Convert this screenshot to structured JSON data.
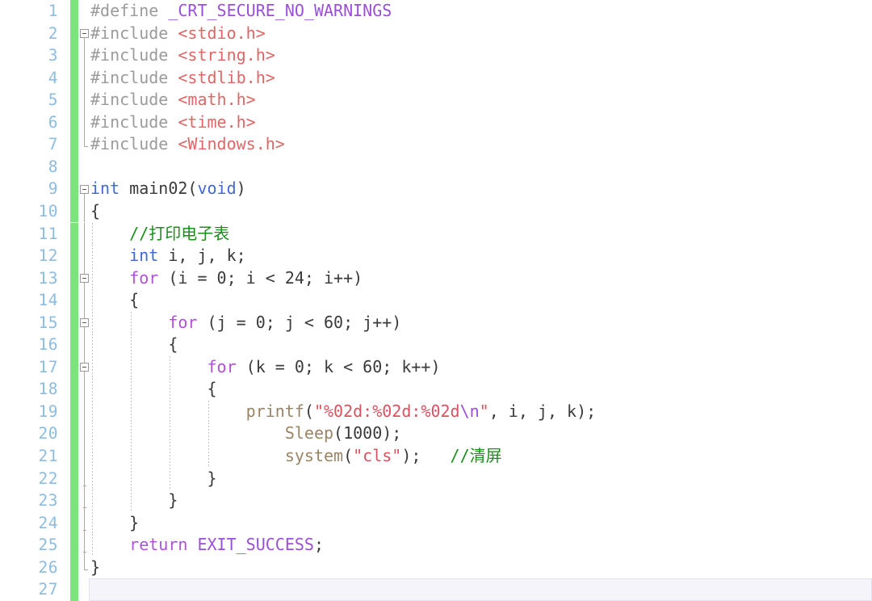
{
  "editor": {
    "name": "code-editor",
    "language": "C",
    "gutter_accent_color": "#7ce47c",
    "line_number_color": "#8cbce0",
    "background_color": "#ffffff",
    "current_line": 27,
    "first_line": 1,
    "last_line": 27,
    "total_lines": 27
  },
  "lines": [
    {
      "n": "1",
      "indent": 0,
      "fold": "none",
      "text": "#define _CRT_SECURE_NO_WARNINGS"
    },
    {
      "n": "2",
      "indent": 0,
      "fold": "start",
      "text": "#include <stdio.h>"
    },
    {
      "n": "3",
      "indent": 0,
      "fold": "body",
      "text": "#include <string.h>"
    },
    {
      "n": "4",
      "indent": 0,
      "fold": "body",
      "text": "#include <stdlib.h>"
    },
    {
      "n": "5",
      "indent": 0,
      "fold": "body",
      "text": "#include <math.h>"
    },
    {
      "n": "6",
      "indent": 0,
      "fold": "body",
      "text": "#include <time.h>"
    },
    {
      "n": "7",
      "indent": 0,
      "fold": "end",
      "text": "#include <Windows.h>"
    },
    {
      "n": "8",
      "indent": 0,
      "fold": "none",
      "text": ""
    },
    {
      "n": "9",
      "indent": 0,
      "fold": "start",
      "text": "int main02(void)"
    },
    {
      "n": "10",
      "indent": 0,
      "fold": "body",
      "text": "{"
    },
    {
      "n": "11",
      "indent": 1,
      "fold": "body",
      "text": "    //打印电子表"
    },
    {
      "n": "12",
      "indent": 1,
      "fold": "body",
      "text": "    int i, j, k;"
    },
    {
      "n": "13",
      "indent": 1,
      "fold": "body",
      "text": "    for (i = 0; i < 24; i++)"
    },
    {
      "n": "14",
      "indent": 1,
      "fold": "body",
      "text": "    {"
    },
    {
      "n": "15",
      "indent": 2,
      "fold": "body",
      "text": "        for (j = 0; j < 60; j++)"
    },
    {
      "n": "16",
      "indent": 2,
      "fold": "body",
      "text": "        {"
    },
    {
      "n": "17",
      "indent": 3,
      "fold": "body",
      "text": "            for (k = 0; k < 60; k++)"
    },
    {
      "n": "18",
      "indent": 3,
      "fold": "body",
      "text": "            {"
    },
    {
      "n": "19",
      "indent": 4,
      "fold": "body",
      "text": "                printf(\"%02d:%02d:%02d\\n\", i, j, k);"
    },
    {
      "n": "20",
      "indent": 4,
      "fold": "body",
      "text": "                    Sleep(1000);"
    },
    {
      "n": "21",
      "indent": 4,
      "fold": "body",
      "text": "                    system(\"cls\");   //清屏"
    },
    {
      "n": "22",
      "indent": 3,
      "fold": "body",
      "text": "            }"
    },
    {
      "n": "23",
      "indent": 2,
      "fold": "body",
      "text": "        }"
    },
    {
      "n": "24",
      "indent": 1,
      "fold": "body",
      "text": "    }"
    },
    {
      "n": "25",
      "indent": 1,
      "fold": "body",
      "text": "    return EXIT_SUCCESS;"
    },
    {
      "n": "26",
      "indent": 0,
      "fold": "end",
      "text": "}"
    },
    {
      "n": "27",
      "indent": 0,
      "fold": "none",
      "text": ""
    }
  ],
  "code_tokens": {
    "l1": [
      [
        "#define ",
        "t-pre"
      ],
      [
        "_CRT_SECURE_NO_WARNINGS",
        "t-macro"
      ]
    ],
    "l2": [
      [
        "#include ",
        "t-pre"
      ],
      [
        "<stdio.h>",
        "t-header"
      ]
    ],
    "l3": [
      [
        "#include ",
        "t-pre"
      ],
      [
        "<string.h>",
        "t-header"
      ]
    ],
    "l4": [
      [
        "#include ",
        "t-pre"
      ],
      [
        "<stdlib.h>",
        "t-header"
      ]
    ],
    "l5": [
      [
        "#include ",
        "t-pre"
      ],
      [
        "<math.h>",
        "t-header"
      ]
    ],
    "l6": [
      [
        "#include ",
        "t-pre"
      ],
      [
        "<time.h>",
        "t-header"
      ]
    ],
    "l7": [
      [
        "#include ",
        "t-pre"
      ],
      [
        "<Windows.h>",
        "t-header"
      ]
    ],
    "l8": [],
    "l9": [
      [
        "int",
        "t-kw"
      ],
      [
        " main02(",
        "t-plain"
      ],
      [
        "void",
        "t-kw"
      ],
      [
        ")",
        "t-plain"
      ]
    ],
    "l10": [
      [
        "{",
        "t-plain"
      ]
    ],
    "l11": [
      [
        "    ",
        "t-plain"
      ],
      [
        "//打印电子表",
        "t-comment"
      ]
    ],
    "l12": [
      [
        "    ",
        "t-plain"
      ],
      [
        "int",
        "t-kw"
      ],
      [
        " i, j, k;",
        "t-plain"
      ]
    ],
    "l13": [
      [
        "    ",
        "t-plain"
      ],
      [
        "for",
        "t-ctrl"
      ],
      [
        " (i = 0; i < 24; i++)",
        "t-plain"
      ]
    ],
    "l14": [
      [
        "    {",
        "t-plain"
      ]
    ],
    "l15": [
      [
        "        ",
        "t-plain"
      ],
      [
        "for",
        "t-ctrl"
      ],
      [
        " (j = 0; j < 60; j++)",
        "t-plain"
      ]
    ],
    "l16": [
      [
        "        {",
        "t-plain"
      ]
    ],
    "l17": [
      [
        "            ",
        "t-plain"
      ],
      [
        "for",
        "t-ctrl"
      ],
      [
        " (k = 0; k < 60; k++)",
        "t-plain"
      ]
    ],
    "l18": [
      [
        "            {",
        "t-plain"
      ]
    ],
    "l19": [
      [
        "                ",
        "t-plain"
      ],
      [
        "printf",
        "t-fn"
      ],
      [
        "(",
        "t-plain"
      ],
      [
        "\"%02d:%02d:%02d",
        "t-string"
      ],
      [
        "\\n",
        "t-escape"
      ],
      [
        "\"",
        "t-string"
      ],
      [
        ", i, j, k);",
        "t-plain"
      ]
    ],
    "l20": [
      [
        "                    ",
        "t-plain"
      ],
      [
        "Sleep",
        "t-fn"
      ],
      [
        "(1000);",
        "t-plain"
      ]
    ],
    "l21": [
      [
        "                    ",
        "t-plain"
      ],
      [
        "system",
        "t-fn"
      ],
      [
        "(",
        "t-plain"
      ],
      [
        "\"cls\"",
        "t-string"
      ],
      [
        "); ",
        "t-plain"
      ],
      [
        "  //清屏",
        "t-comment"
      ]
    ],
    "l22": [
      [
        "            }",
        "t-plain"
      ]
    ],
    "l23": [
      [
        "        }",
        "t-plain"
      ]
    ],
    "l24": [
      [
        "    }",
        "t-plain"
      ]
    ],
    "l25": [
      [
        "    ",
        "t-plain"
      ],
      [
        "return",
        "t-ctrl"
      ],
      [
        " ",
        "t-plain"
      ],
      [
        "EXIT_SUCCESS",
        "t-macro"
      ],
      [
        ";",
        "t-plain"
      ]
    ],
    "l26": [
      [
        "}",
        "t-plain"
      ]
    ],
    "l27": []
  }
}
